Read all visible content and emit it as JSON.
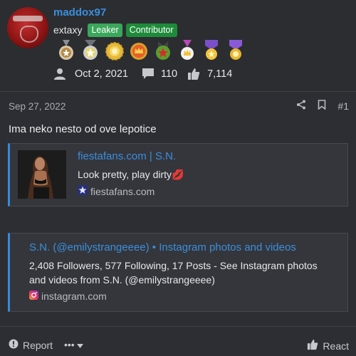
{
  "user": {
    "username": "maddox97",
    "user_title": "extaxy",
    "badges": [
      "Leaker",
      "Contributor"
    ],
    "trophies": [
      "bronze-star-medal",
      "silver-star-medal",
      "gold-sunburst-medal",
      "gold-crown-medal",
      "green-star-medal",
      "crown-ribbon-medal",
      "purple-ribbon-medal",
      "purple-ribbon-medal-2"
    ],
    "joined": "Oct 2, 2021",
    "messages": "110",
    "reactions": "7,114"
  },
  "post": {
    "date": "Sep 27, 2022",
    "number": "#1",
    "text": "Ima neko nesto od ove lepotice"
  },
  "embeds": [
    {
      "title": "fiestafans.com | S.N.",
      "description": "Look pretty, play dirty💋",
      "site": "fiestafans.com"
    },
    {
      "title": "S.N. (@emilystrangeeee) • Instagram photos and videos",
      "description_line1": "2,408 Followers, 577 Following, 17 Posts - See Instagram photos",
      "description_line2": "and videos from S.N. (@emilystrangeeee)",
      "site": "instagram.com"
    }
  ],
  "footer": {
    "report": "Report",
    "more": "•••",
    "react": "React"
  },
  "colors": {
    "link": "#3b8edc",
    "leaker_badge": "#3aa75a",
    "contributor_badge": "#1e8b39",
    "background": "#2c2e33"
  }
}
